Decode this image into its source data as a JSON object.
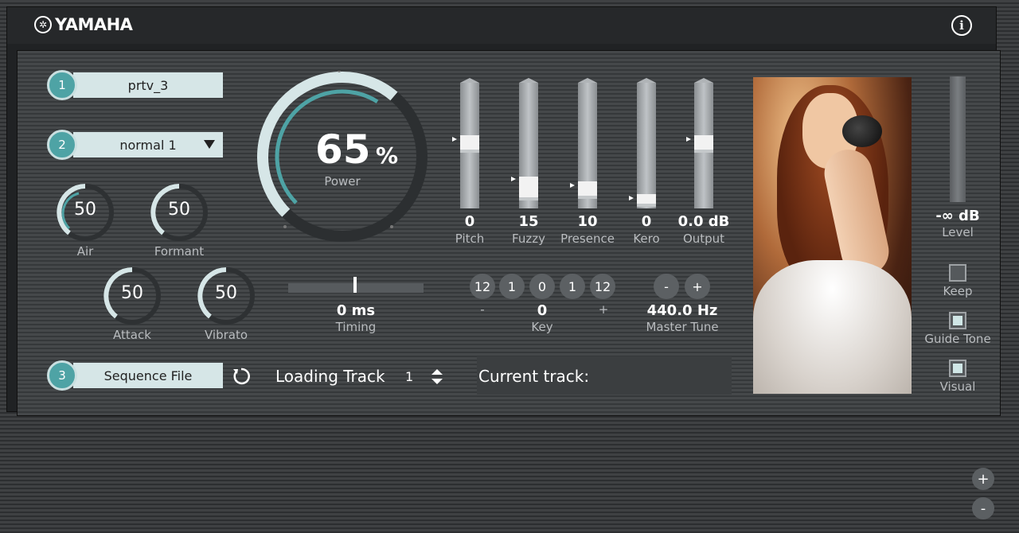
{
  "header": {
    "brand": "YAMAHA",
    "info_glyph": "i"
  },
  "rows": [
    {
      "num": "1",
      "value": "prtv_3"
    },
    {
      "num": "2",
      "value": "normal 1"
    },
    {
      "num": "3",
      "value": "Sequence File"
    }
  ],
  "knobs": {
    "air": {
      "value": "50",
      "label": "Air"
    },
    "formant": {
      "value": "50",
      "label": "Formant"
    },
    "attack": {
      "value": "50",
      "label": "Attack"
    },
    "vibrato": {
      "value": "50",
      "label": "Vibrato"
    }
  },
  "power": {
    "value": "65",
    "unit": "%",
    "label": "Power",
    "level_percent": 65
  },
  "timing": {
    "value": "0 ms",
    "label": "Timing"
  },
  "sliders": [
    {
      "value": "0",
      "label": "Pitch"
    },
    {
      "value": "15",
      "label": "Fuzzy"
    },
    {
      "value": "10",
      "label": "Presence"
    },
    {
      "value": "0",
      "label": "Kero"
    },
    {
      "value": "0.0 dB",
      "label": "Output"
    }
  ],
  "key": {
    "buttons": [
      "12",
      "1",
      "0",
      "1",
      "12"
    ],
    "minus": "-",
    "value": "0",
    "plus": "+",
    "label": "Key"
  },
  "master_tune": {
    "minus": "-",
    "plus": "+",
    "value": "440.0 Hz",
    "label": "Master Tune"
  },
  "loading": {
    "label": "Loading Track",
    "value": "1",
    "current_label": "Current track:"
  },
  "level": {
    "value": "-∞ dB",
    "label": "Level"
  },
  "checks": [
    {
      "label": "Keep",
      "checked": false
    },
    {
      "label": "Guide Tone",
      "checked": true
    },
    {
      "label": "Visual",
      "checked": true
    }
  ],
  "zoom": {
    "plus": "+",
    "minus": "-"
  },
  "colors": {
    "accent": "#4ea3a5",
    "field": "#d6e6e7"
  }
}
